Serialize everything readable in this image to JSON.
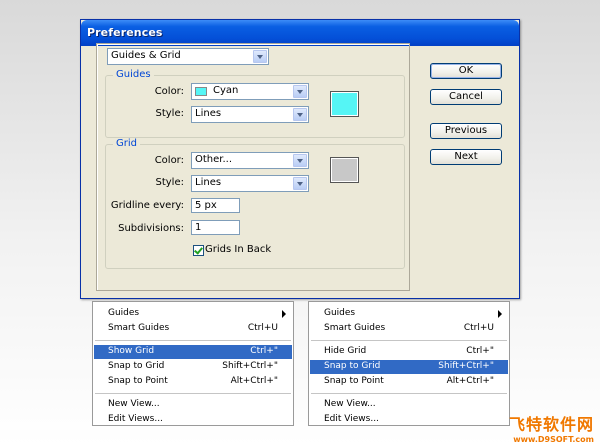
{
  "dialog": {
    "title": "Preferences",
    "pane_select": "Guides & Grid",
    "guides": {
      "legend": "Guides",
      "color_label": "Color:",
      "color_value": "Cyan",
      "color_hex": "#55f5f5",
      "style_label": "Style:",
      "style_value": "Lines"
    },
    "grid": {
      "legend": "Grid",
      "color_label": "Color:",
      "color_value": "Other...",
      "color_hex": "#c8c8c8",
      "style_label": "Style:",
      "style_value": "Lines",
      "gridline_label": "Gridline every:",
      "gridline_value": "5 px",
      "subdivisions_label": "Subdivisions:",
      "subdivisions_value": "1",
      "grids_in_back_label": "Grids In Back",
      "grids_in_back_checked": true
    },
    "buttons": {
      "ok": "OK",
      "cancel": "Cancel",
      "previous": "Previous",
      "next": "Next"
    }
  },
  "menus": [
    {
      "items": [
        {
          "label": "Guides",
          "shortcut": "",
          "submenu": true,
          "selected": false
        },
        {
          "label": "Smart Guides",
          "shortcut": "Ctrl+U",
          "submenu": false,
          "selected": false
        },
        {
          "separator": true
        },
        {
          "label": "Show Grid",
          "shortcut": "Ctrl+\"",
          "submenu": false,
          "selected": true
        },
        {
          "label": "Snap to Grid",
          "shortcut": "Shift+Ctrl+\"",
          "submenu": false,
          "selected": false
        },
        {
          "label": "Snap to Point",
          "shortcut": "Alt+Ctrl+\"",
          "submenu": false,
          "selected": false
        },
        {
          "separator": true
        },
        {
          "label": "New View...",
          "shortcut": "",
          "submenu": false,
          "selected": false
        },
        {
          "label": "Edit Views...",
          "shortcut": "",
          "submenu": false,
          "selected": false
        }
      ]
    },
    {
      "items": [
        {
          "label": "Guides",
          "shortcut": "",
          "submenu": true,
          "selected": false
        },
        {
          "label": "Smart Guides",
          "shortcut": "Ctrl+U",
          "submenu": false,
          "selected": false
        },
        {
          "separator": true
        },
        {
          "label": "Hide Grid",
          "shortcut": "Ctrl+\"",
          "submenu": false,
          "selected": false
        },
        {
          "label": "Snap to Grid",
          "shortcut": "Shift+Ctrl+\"",
          "submenu": false,
          "selected": true
        },
        {
          "label": "Snap to Point",
          "shortcut": "Alt+Ctrl+\"",
          "submenu": false,
          "selected": false
        },
        {
          "separator": true
        },
        {
          "label": "New View...",
          "shortcut": "",
          "submenu": false,
          "selected": false
        },
        {
          "label": "Edit Views...",
          "shortcut": "",
          "submenu": false,
          "selected": false
        }
      ]
    }
  ],
  "watermark": {
    "main": "飞特软件网",
    "sub": "www.D9SOFT.com"
  },
  "colors": {
    "title_bar": "#0450d8",
    "dialog_bg": "#ece9d8",
    "menu_highlight": "#316ac5",
    "legend_text": "#0046d5"
  }
}
